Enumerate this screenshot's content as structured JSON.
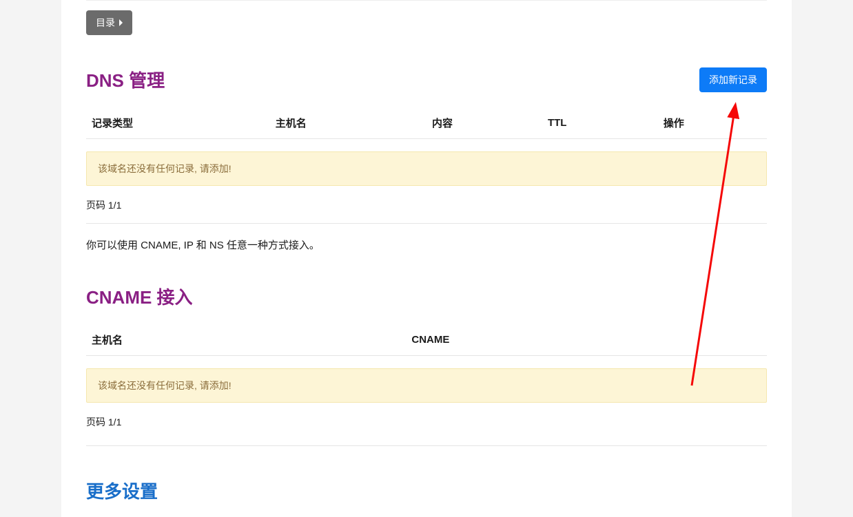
{
  "toc_label": "目录",
  "dns": {
    "title": "DNS 管理",
    "add_label": "添加新记录",
    "headers": {
      "type": "记录类型",
      "host": "主机名",
      "content": "内容",
      "ttl": "TTL",
      "action": "操作"
    },
    "empty_alert": "该域名还没有任何记录, 请添加!",
    "pager": "页码 1/1",
    "note": "你可以使用 CNAME, IP 和 NS 任意一种方式接入。"
  },
  "cname": {
    "title": "CNAME 接入",
    "headers": {
      "host": "主机名",
      "cname": "CNAME"
    },
    "empty_alert": "该域名还没有任何记录, 请添加!",
    "pager": "页码 1/1"
  },
  "more_settings_title": "更多设置",
  "colors": {
    "accent_purple": "#8a2084",
    "accent_blue": "#0d7bf7",
    "link_blue": "#196ec9",
    "arrow_red": "#f50808"
  }
}
